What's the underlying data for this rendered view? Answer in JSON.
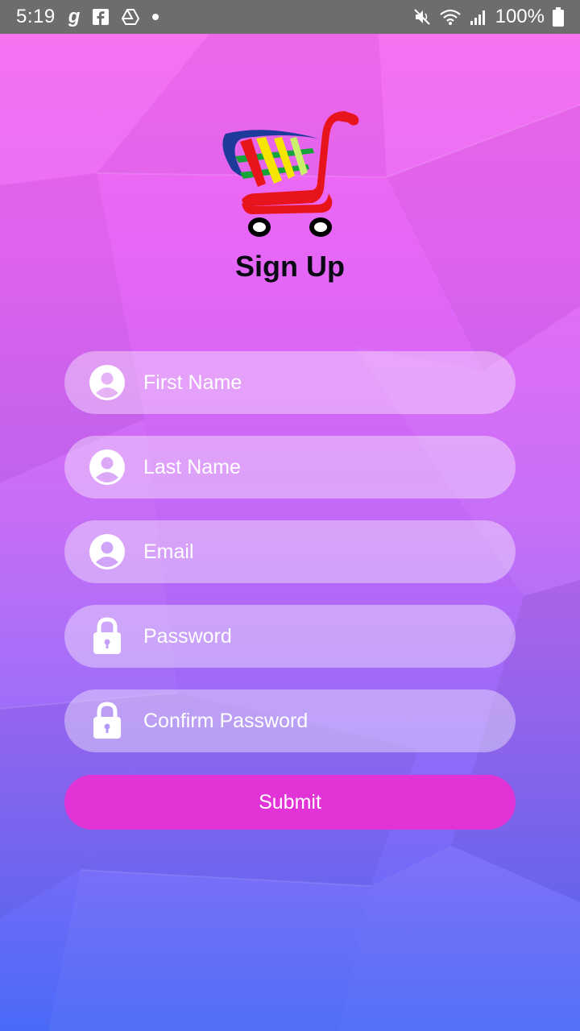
{
  "status_bar": {
    "time": "5:19",
    "battery_text": "100%",
    "left_icons": [
      "g-app-icon",
      "facebook-icon",
      "drive-icon",
      "dot-icon"
    ],
    "right_icons": [
      "mute-icon",
      "wifi-icon",
      "signal-icon",
      "battery-icon"
    ]
  },
  "page": {
    "title": "Sign Up"
  },
  "form": {
    "fields": [
      {
        "placeholder": "First Name",
        "icon": "person-icon"
      },
      {
        "placeholder": "Last Name",
        "icon": "person-icon"
      },
      {
        "placeholder": "Email",
        "icon": "person-icon"
      },
      {
        "placeholder": "Password",
        "icon": "lock-icon"
      },
      {
        "placeholder": "Confirm Password",
        "icon": "lock-icon"
      }
    ],
    "submit_label": "Submit"
  },
  "colors": {
    "gradient_top": "#f86cf0",
    "gradient_bottom": "#4a6af8",
    "submit_button": "#e233d6",
    "status_bar": "#6d6d6d"
  }
}
